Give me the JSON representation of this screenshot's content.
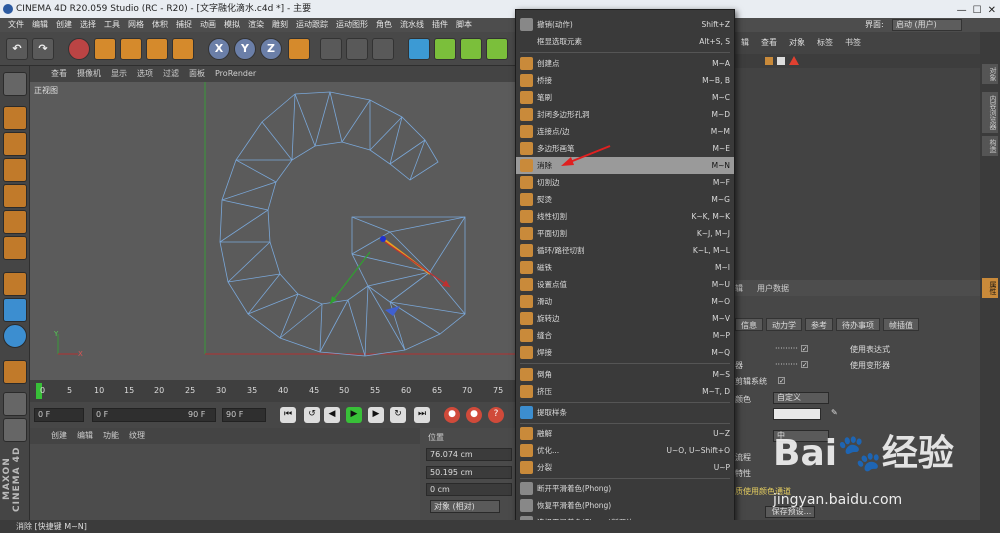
{
  "window": {
    "title": "CINEMA 4D R20.059 Studio (RC - R20) - [文字融化滴水.c4d *] - 主要",
    "controls": [
      "—",
      "☐",
      "✕"
    ]
  },
  "menubar": {
    "items": [
      "文件",
      "编辑",
      "创建",
      "选择",
      "工具",
      "网格",
      "体积",
      "捕捉",
      "动画",
      "模拟",
      "渲染",
      "雕刻",
      "运动跟踪",
      "运动图形",
      "角色",
      "流水线",
      "插件",
      "脚本"
    ]
  },
  "interface": {
    "label": "界面:",
    "value": "启动 (用户)"
  },
  "toolbar": {
    "undo": "↶",
    "redo": "↷",
    "x": "X",
    "y": "Y",
    "z": "Z"
  },
  "viewport": {
    "menu": [
      "查看",
      "摄像机",
      "显示",
      "选项",
      "过滤",
      "面板",
      "ProRender"
    ],
    "label": "正视图",
    "axis_y": "Y",
    "axis_x": "X"
  },
  "timeline": {
    "ticks": [
      "0",
      "5",
      "10",
      "15",
      "20",
      "25",
      "30",
      "35",
      "40",
      "45",
      "50",
      "55",
      "60",
      "65",
      "70",
      "75"
    ]
  },
  "transport": {
    "frame_start": "0 F",
    "frame_current": "0 F",
    "frame_mid": "90 F",
    "frame_end": "90 F"
  },
  "materials": {
    "menu": [
      "创建",
      "编辑",
      "功能",
      "纹理"
    ]
  },
  "coordinates": {
    "header": "位置",
    "x": "76.074 cm",
    "y": "50.195 cm",
    "z": "0 cm",
    "mode": "对象 (相对)"
  },
  "context_menu": {
    "items": [
      {
        "label": "撤销(动作)",
        "key": "Shift+Z"
      },
      {
        "label": "框显选取元素",
        "key": "Alt+S, S"
      },
      {
        "label": "创建点",
        "key": "M~A"
      },
      {
        "label": "桥接",
        "key": "M~B, B"
      },
      {
        "label": "笔刷",
        "key": "M~C"
      },
      {
        "label": "封闭多边形孔洞",
        "key": "M~D"
      },
      {
        "label": "连接点/边",
        "key": "M~M"
      },
      {
        "label": "多边形画笔",
        "key": "M~E"
      },
      {
        "label": "消除",
        "key": "M~N"
      },
      {
        "label": "切割边",
        "key": "M~F"
      },
      {
        "label": "熨烫",
        "key": "M~G"
      },
      {
        "label": "线性切割",
        "key": "K~K, M~K"
      },
      {
        "label": "平面切割",
        "key": "K~J, M~J"
      },
      {
        "label": "循环/路径切割",
        "key": "K~L, M~L"
      },
      {
        "label": "磁铁",
        "key": "M~I"
      },
      {
        "label": "设置点值",
        "key": "M~U"
      },
      {
        "label": "滑动",
        "key": "M~O"
      },
      {
        "label": "旋转边",
        "key": "M~V"
      },
      {
        "label": "缝合",
        "key": "M~P"
      },
      {
        "label": "焊接",
        "key": "M~Q"
      },
      {
        "label": "倒角",
        "key": "M~S"
      },
      {
        "label": "挤压",
        "key": "M~T, D"
      },
      {
        "label": "提取样条",
        "key": ""
      },
      {
        "label": "融解",
        "key": "U~Z"
      },
      {
        "label": "优化...",
        "key": "U~O, U~Shift+O"
      },
      {
        "label": "分裂",
        "key": "U~P"
      },
      {
        "label": "断开平滑着色(Phong)",
        "key": ""
      },
      {
        "label": "恢复平滑着色(Phong)",
        "key": ""
      },
      {
        "label": "选择平滑着色(Phong)断开边",
        "key": ""
      }
    ],
    "highlighted": "消除"
  },
  "object_manager": {
    "tabs": [
      "辑",
      "查看",
      "对象",
      "标签",
      "书签"
    ]
  },
  "right_strip": {
    "tabs": [
      "对象",
      "内容浏览器",
      "构造",
      "属性"
    ]
  },
  "attributes": {
    "menu": [
      "辑",
      "用户数据"
    ],
    "tabs": [
      "信息",
      "动力学",
      "参考",
      "待办事项",
      "帧插值"
    ],
    "rows": {
      "r1_right": "使用表达式",
      "r2_left": "器",
      "r2_right": "使用变形器",
      "r3_left": "剪辑系统",
      "r4_left": "颜色",
      "r4_value": "自定义",
      "r6_value": "中",
      "r7_left": "流程",
      "r8_left": "特性",
      "r9_left": "质使用颜色通道",
      "button": "保存预设..."
    }
  },
  "status": {
    "text": "消除 [快捷键 M~N]"
  },
  "watermark": {
    "logo": "Bai🐾经验",
    "url": "jingyan.baidu.com"
  }
}
